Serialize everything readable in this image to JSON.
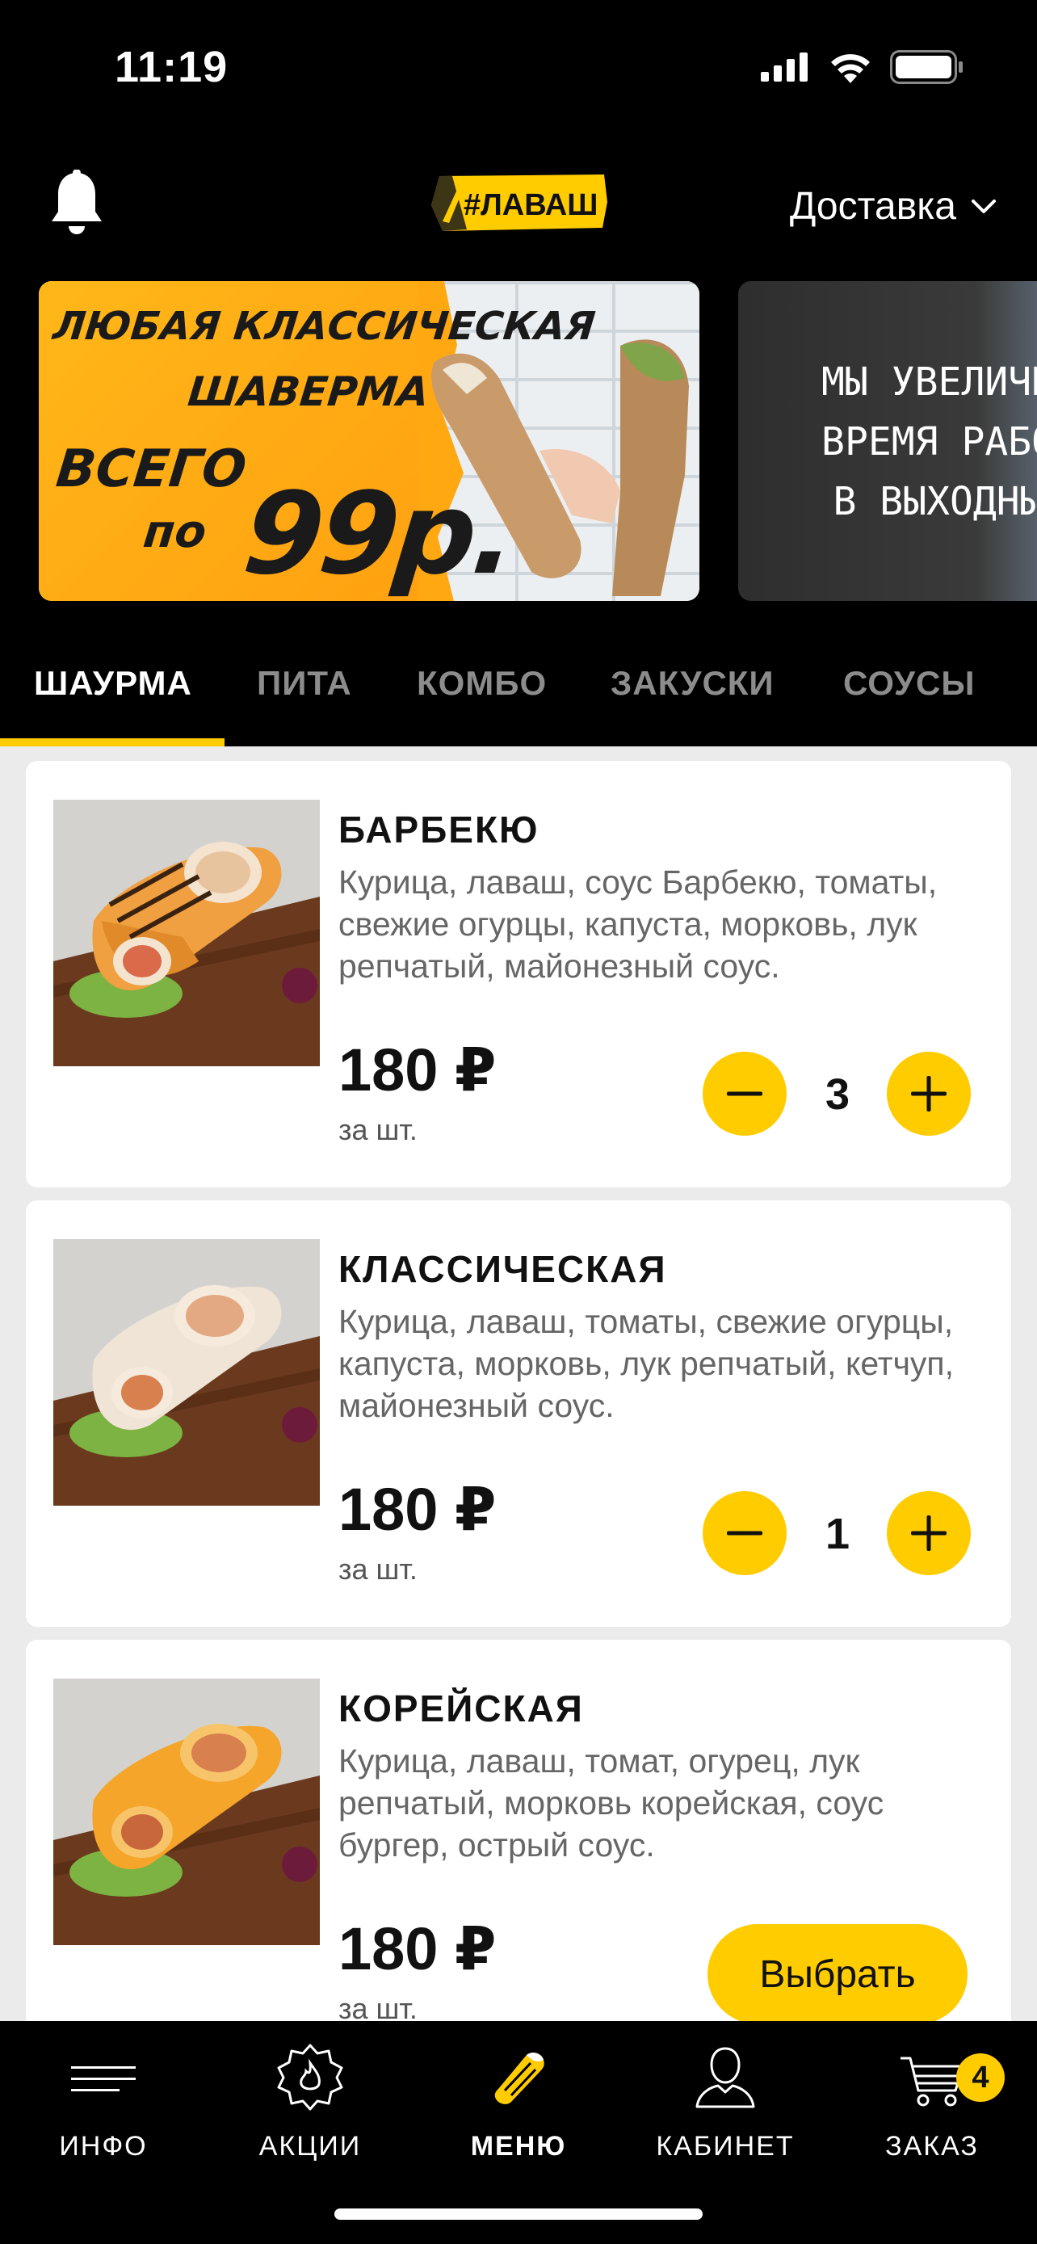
{
  "status_bar": {
    "time": "11:19"
  },
  "header": {
    "logo_text": "#ЛАВАШ",
    "delivery_label": "Доставка"
  },
  "banners": [
    {
      "lines": [
        "ЛЮБАЯ КЛАССИЧЕСКАЯ",
        "ШАВЕРМА",
        "ВСЕГО",
        "по"
      ],
      "price": "99р."
    },
    {
      "text": "МЫ УВЕЛИЧИЛ\nВРЕМЯ РАБОТ\nВ ВЫХОДНЫЕ"
    }
  ],
  "tabs": [
    "ШАУРМА",
    "ПИТА",
    "КОМБО",
    "ЗАКУСКИ",
    "СОУСЫ"
  ],
  "products": [
    {
      "name": "БАРБЕКЮ",
      "description": "Курица, лаваш, соус Барбекю, томаты, свежие огурцы, капуста, морковь, лук репчатый, майонезный соус.",
      "price": "180 ₽",
      "unit": "за шт.",
      "quantity": "3"
    },
    {
      "name": "КЛАССИЧЕСКАЯ",
      "description": "Курица, лаваш, томаты, свежие огурцы, капуста, морковь, лук репчатый, кетчуп, майонезный соус.",
      "price": "180 ₽",
      "unit": "за шт.",
      "quantity": "1"
    },
    {
      "name": "КОРЕЙСКАЯ",
      "description": "Курица, лаваш, томат, огурец, лук репчатый, морковь корейская, соус бургер, острый соус.",
      "price": "180 ₽",
      "unit": "за шт.",
      "choose_label": "Выбрать"
    }
  ],
  "bottom_nav": {
    "items": [
      {
        "label": "ИНФО",
        "icon": "menu-lines-icon"
      },
      {
        "label": "АКЦИИ",
        "icon": "discount-badge-icon"
      },
      {
        "label": "МЕНЮ",
        "icon": "shawarma-icon"
      },
      {
        "label": "КАБИНЕТ",
        "icon": "user-icon"
      },
      {
        "label": "ЗАКАЗ",
        "icon": "cart-icon"
      }
    ],
    "cart_count": "4"
  },
  "colors": {
    "accent": "#ffcc00",
    "background": "#000000",
    "card": "#ffffff",
    "content_bg": "#ebebeb"
  }
}
